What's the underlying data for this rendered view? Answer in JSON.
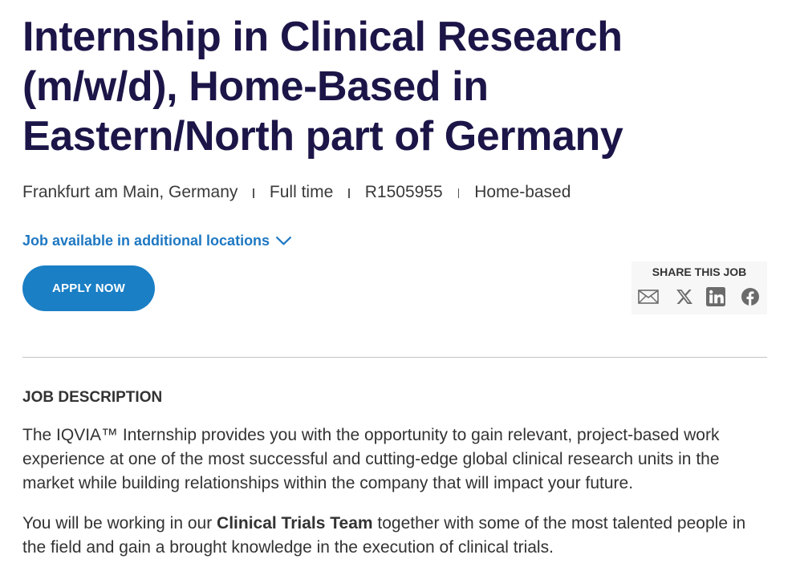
{
  "job": {
    "title": "Internship in Clinical Research (m/w/d), Home-Based in Eastern/North part of Germany",
    "meta": [
      "Frankfurt am Main, Germany",
      "Full time",
      "R1505955",
      "Home-based"
    ],
    "additional_locations_link": "Job available in additional locations",
    "apply_button": "APPLY NOW"
  },
  "share": {
    "heading": "SHARE THIS JOB",
    "icons": [
      "mail-icon",
      "x-icon",
      "linkedin-icon",
      "facebook-icon"
    ]
  },
  "description": {
    "heading": "JOB DESCRIPTION",
    "paragraph_1": "The IQVIA™ Internship provides you with the opportunity to gain relevant, project-based work experience at one of the most successful and cutting-edge global clinical research units in the market while building relationships within the company that will impact your future.",
    "paragraph_2": {
      "before": "You will be working in our ",
      "bold": "Clinical Trials Team",
      "after": " together with some of the most talented people in the field and gain a brought knowledge in the execution of clinical trials."
    }
  },
  "colors": {
    "title": "#1c1548",
    "accent": "#1a7fc5",
    "link": "#1e78c2",
    "text": "#333333",
    "icon": "#6b6b6b",
    "divider": "#c4c4c4"
  }
}
